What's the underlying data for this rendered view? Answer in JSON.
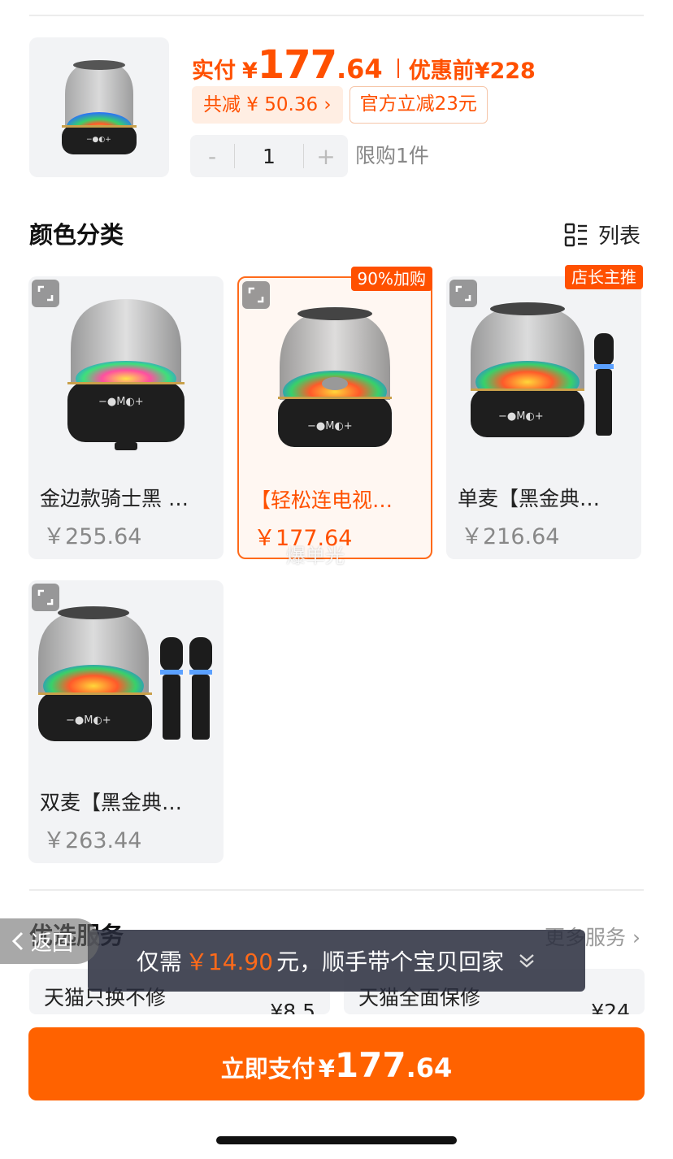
{
  "header": {
    "pay_label": "实付",
    "currency": "¥",
    "price_int": "177",
    "price_dec": ".64",
    "orig_label": "优惠前",
    "orig_price": "¥228",
    "total_discount": "共减 ¥ 50.36 ›",
    "official_discount": "官方立减23元",
    "quantity": "1",
    "minus": "-",
    "plus": "+",
    "limit": "限购1件"
  },
  "variants_section": {
    "title": "颜色分类",
    "view_toggle": "列表"
  },
  "variants": [
    {
      "name": "金边款骑士黑 …",
      "price": "￥255.64",
      "tag": ""
    },
    {
      "name": "【轻松连电视…",
      "price": "￥177.64",
      "tag": "90%加购"
    },
    {
      "name": "单麦【黑金典…",
      "price": "￥216.64",
      "tag": "店长主推"
    },
    {
      "name": "双麦【黑金典…",
      "price": "￥263.44",
      "tag": ""
    }
  ],
  "watermark": "爆单光",
  "services": {
    "title": "优选服务",
    "more": "更多服务 ›",
    "items": [
      {
        "name": "天猫只换不修",
        "price": "¥8.5"
      },
      {
        "name": "天猫全面保修",
        "price": "¥24"
      }
    ]
  },
  "back": {
    "label": "返回"
  },
  "toast": {
    "pre": "仅需",
    "amount": "￥14.90",
    "post": "元，顺手带个宝贝回家"
  },
  "pay_button": {
    "label": "立即支付",
    "currency": "¥",
    "int": "177",
    "dec": ".64"
  },
  "colors": {
    "accent": "#ff5000",
    "button": "#ff6200"
  }
}
